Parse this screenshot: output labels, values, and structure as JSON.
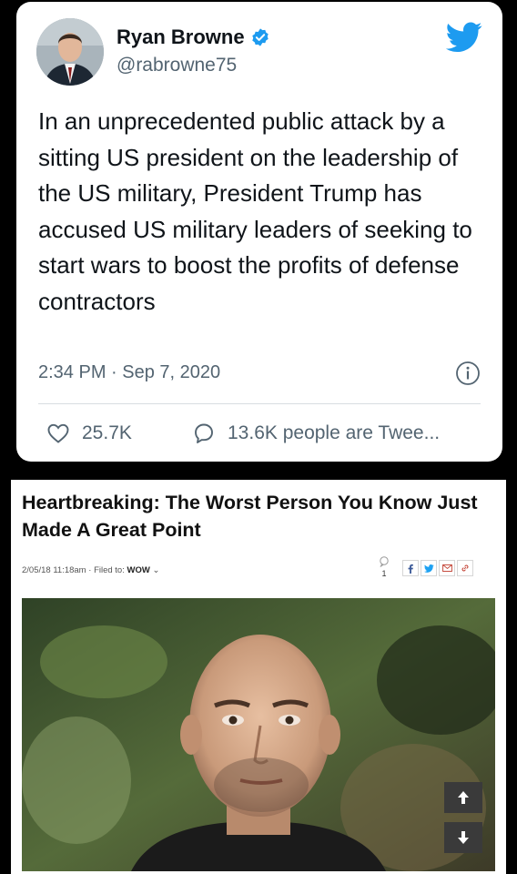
{
  "tweet": {
    "author_name": "Ryan Browne",
    "handle": "@rabrowne75",
    "verified": true,
    "text": "In an unprecedented public attack by a sitting US president on the leadership of the US military, President Trump has accused US military leaders of seeking to start wars to boost the profits of defense contractors",
    "timestamp": "2:34 PM · Sep 7, 2020",
    "likes": "25.7K",
    "replies": "13.6K people are Twee...",
    "accent": "#1d9bf0"
  },
  "article": {
    "headline": "Heartbreaking: The Worst Person You Know Just Made A Great Point",
    "date": "2/05/18 11:18am",
    "filed_label": "Filed to:",
    "filed_value": "WOW",
    "comment_count": "1",
    "share_icons": [
      "facebook-icon",
      "twitter-icon",
      "email-icon",
      "link-icon"
    ]
  }
}
